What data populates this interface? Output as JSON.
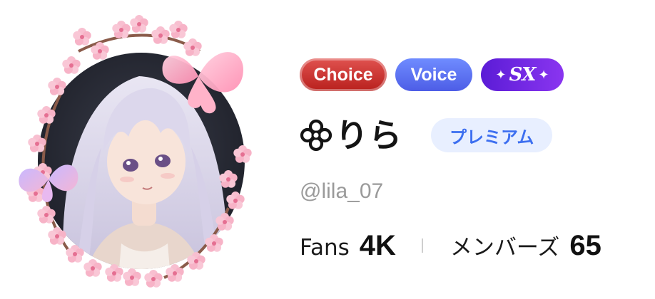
{
  "profile": {
    "avatar_alt": "avatar",
    "badges": {
      "choice": "Choice",
      "voice": "Voice",
      "sx_spark_left": "✦",
      "sx_text": "SX",
      "sx_spark_right": "✦"
    },
    "display_name": "りら",
    "premium_label": "プレミアム",
    "username": "@lila_07",
    "stats": {
      "fans_label": "Fans",
      "fans_value": "4K",
      "members_label": "メンバーズ",
      "members_value": "65"
    }
  },
  "colors": {
    "choice_badge": "#c62d2a",
    "voice_badge": "#5b6ff0",
    "sx_badge": "#6f28e6",
    "premium_text": "#3d6ff0",
    "premium_bg": "#e8efff",
    "username": "#9a9a9a"
  },
  "icons": {
    "name_prefix": "flower-icon"
  }
}
